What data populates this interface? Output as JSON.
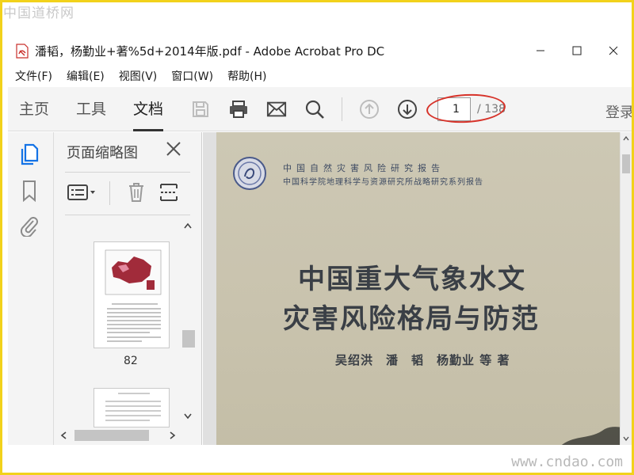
{
  "watermarks": {
    "top": "中国道桥网",
    "bottom": "www.cndao.com"
  },
  "window": {
    "title": "潘韬，杨勤业+著%5d+2014年版.pdf - Adobe Acrobat Pro DC",
    "controls": [
      "minimize-icon",
      "maximize-icon",
      "close-icon"
    ]
  },
  "menu": [
    "文件(F)",
    "编辑(E)",
    "视图(V)",
    "窗口(W)",
    "帮助(H)"
  ],
  "toolbar": {
    "tabs": [
      "主页",
      "工具",
      "文档"
    ],
    "active_tab": "文档",
    "icons": [
      "save-icon",
      "print-icon",
      "email-icon",
      "search-icon",
      "prev-page-icon",
      "next-page-icon"
    ],
    "page_current": "1",
    "page_total": "/ 138",
    "login": "登录"
  },
  "left_icons": [
    "pages-icon",
    "bookmark-icon",
    "attachment-icon"
  ],
  "thumb_panel": {
    "title": "页面缩略图",
    "thumbnails": [
      {
        "label": "82"
      },
      {
        "label": ""
      }
    ]
  },
  "document": {
    "header_line1": "中国自然灾害风险研究报告",
    "header_line2": "中国科学院地理科学与资源研究所战略研究系列报告",
    "title_line1": "中国重大气象水文",
    "title_line2": "灾害风险格局与防范",
    "authors": "吴绍洪　潘　韬　杨勤业 等 著"
  },
  "colors": {
    "accent": "#1473e6",
    "highlight": "#d7332a",
    "frame": "#f2d21b"
  }
}
